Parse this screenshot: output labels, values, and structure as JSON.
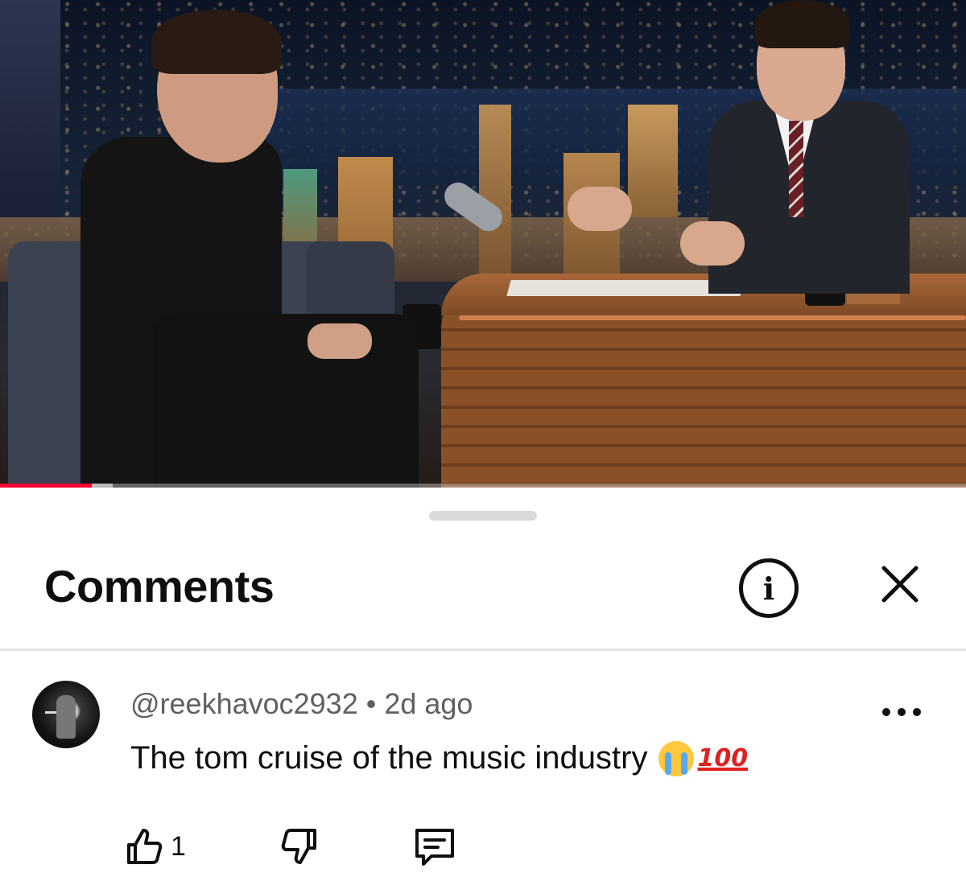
{
  "video": {
    "progress_fraction": 0.095,
    "buffered_fraction": 0.117,
    "colors": {
      "progress": "#ff0033"
    }
  },
  "comments_panel": {
    "title": "Comments",
    "info_icon": "info-icon",
    "close_icon": "close-icon",
    "comments": [
      {
        "author": "@reekhavoc2932",
        "separator": "•",
        "time": "2d ago",
        "text": "The tom cruise of the music industry",
        "emojis": [
          "loudly-crying-face",
          "hundred-points"
        ],
        "hundred_emoji_text": "100",
        "like_count": "1",
        "actions": [
          "thumb-up-icon",
          "thumb-down-icon",
          "reply-icon",
          "more-icon"
        ]
      }
    ]
  }
}
